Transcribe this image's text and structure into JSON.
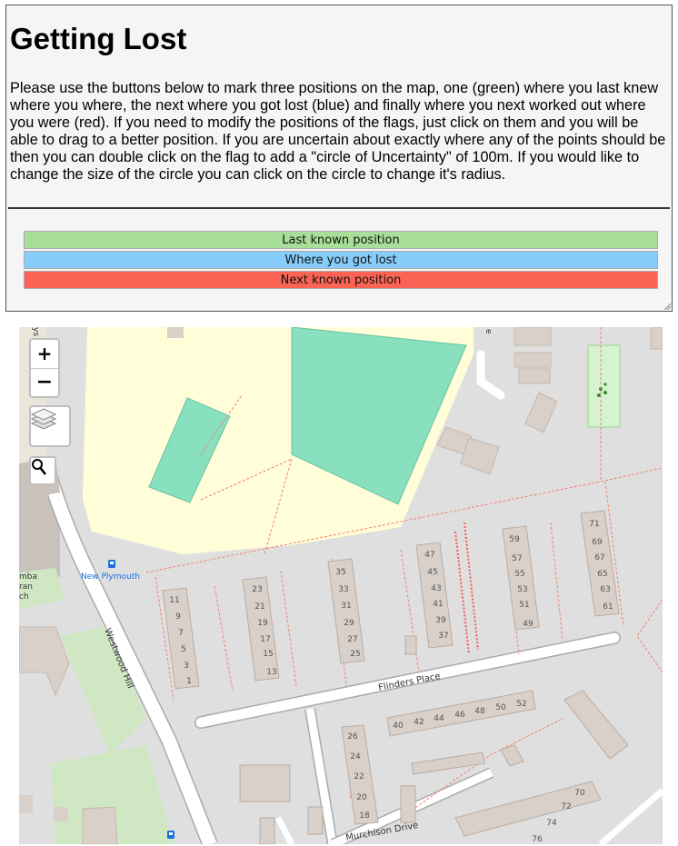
{
  "header": {
    "title": "Getting Lost",
    "instructions": "Please use the buttons below to mark three positions on the map, one (green) where you last knew where you where, the next where you got lost (blue) and finally where you next worked out where you were (red). If you need to modify the positions of the flags, just click on them and you will be able to drag to a better position. If you are uncertain about exactly where any of the points should be then you can double click on the flag to add a \"circle of Uncertainty\" of 100m. If you would like to change the size of the circle you can click on the circle to change it's radius."
  },
  "buttons": {
    "last_known": "Last known position",
    "got_lost": "Where you got lost",
    "next_known": "Next known position"
  },
  "colors": {
    "last_known": "#a8df98",
    "got_lost": "#87cdfb",
    "next_known": "#fb6455"
  },
  "map": {
    "zoom_in": "+",
    "zoom_out": "−",
    "icons": [
      "zoom-in-icon",
      "zoom-out-icon",
      "layers-icon",
      "search-icon",
      "bus-stop-icon"
    ],
    "streets": {
      "westwood_hill": "Westwood Hill",
      "flinders_place": "Flinders Place",
      "murchison_drive": "Murchison Drive"
    },
    "places": {
      "new_plymouth": "New Plymouth",
      "partial_label_1": "mba",
      "partial_label_2": "ran",
      "partial_label_3": "ch",
      "partial_top": "ys",
      "partial_e": "e"
    },
    "house_numbers": {
      "col_a": [
        "11",
        "9",
        "7",
        "5",
        "3",
        "1"
      ],
      "col_b": [
        "23",
        "21",
        "19",
        "17",
        "15",
        "13"
      ],
      "col_c": [
        "35",
        "33",
        "31",
        "29",
        "27",
        "25"
      ],
      "col_d": [
        "47",
        "45",
        "43",
        "41",
        "39",
        "37"
      ],
      "col_e": [
        "59",
        "57",
        "55",
        "53",
        "51",
        "49"
      ],
      "col_f": [
        "71",
        "69",
        "67",
        "65",
        "63",
        "61"
      ],
      "row_g": [
        "40",
        "42",
        "44",
        "46",
        "48",
        "50",
        "52"
      ],
      "col_h": [
        "26",
        "24",
        "22",
        "20",
        "18"
      ],
      "diag_i": [
        "70",
        "72",
        "74",
        "76"
      ]
    }
  }
}
